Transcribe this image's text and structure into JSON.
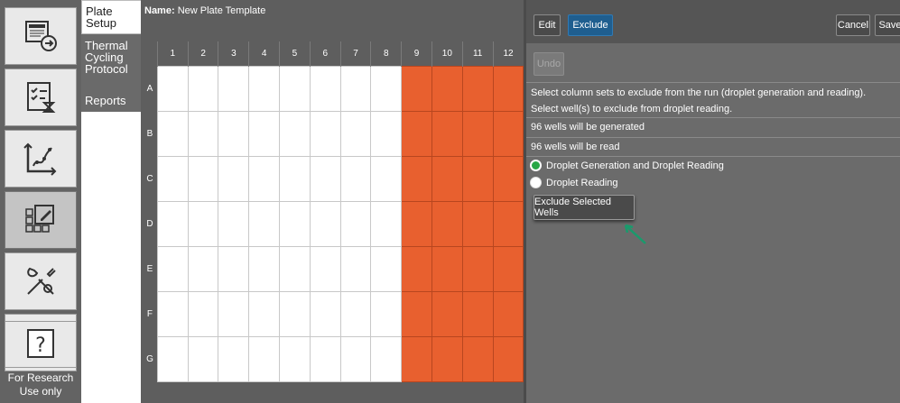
{
  "sidebar": {
    "icons": [
      "export-icon",
      "checklist-timer-icon",
      "chart-icon",
      "plate-edit-icon",
      "tools-icon",
      "user-settings-icon",
      "help-icon"
    ],
    "footer_text": "For Research Use only"
  },
  "subnav": {
    "items": [
      {
        "label": "Plate Setup"
      },
      {
        "label": "Thermal Cycling Protocol"
      },
      {
        "label": "Reports"
      }
    ]
  },
  "plate": {
    "name_label": "Name:",
    "name_value": "New Plate Template",
    "columns": [
      "1",
      "2",
      "3",
      "4",
      "5",
      "6",
      "7",
      "8",
      "9",
      "10",
      "11",
      "12"
    ],
    "rows": [
      "A",
      "B",
      "C",
      "D",
      "E",
      "F",
      "G"
    ],
    "excluded_columns": [
      "9",
      "10",
      "11",
      "12"
    ],
    "colors": {
      "excluded": "#e8602f",
      "normal": "#ffffff"
    }
  },
  "toolbar": {
    "edit_label": "Edit",
    "exclude_label": "Exclude",
    "cancel_label": "Cancel",
    "save_label": "Save",
    "undo_label": "Undo"
  },
  "panel": {
    "instruction_1": "Select column sets to exclude from the run (droplet generation and reading).",
    "instruction_2": "Select well(s) to exclude from droplet reading.",
    "status_generated": "96 wells will be generated",
    "status_read": "96 wells will be read",
    "option_1": "Droplet Generation and Droplet Reading",
    "option_2": "Droplet Reading",
    "exclude_wells_label": "Exclude Selected Wells",
    "accent_color": "#1f5e8f",
    "option_1_color": "#27a745"
  }
}
